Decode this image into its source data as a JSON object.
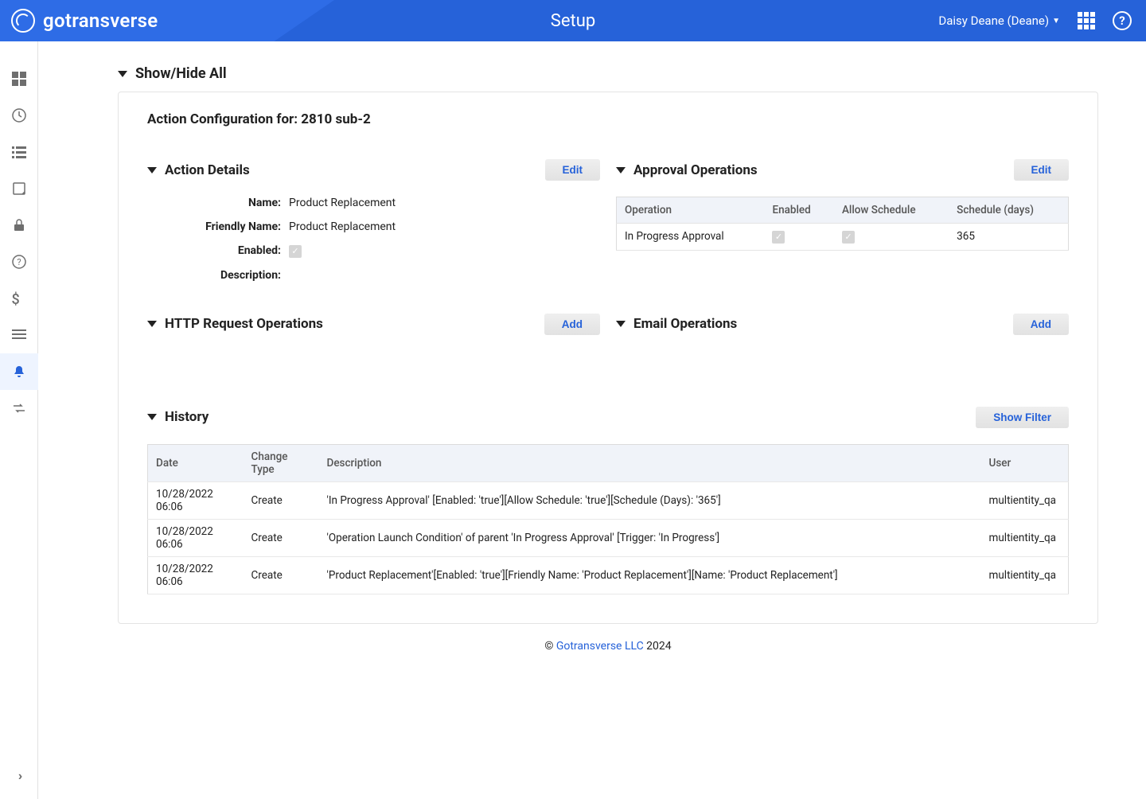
{
  "brand": "gotransverse",
  "header": {
    "title": "Setup",
    "user": "Daisy Deane (Deane)"
  },
  "showhide": "Show/Hide All",
  "card_title": "Action Configuration for: 2810 sub-2",
  "sections": {
    "action_details": {
      "title": "Action Details",
      "button": "Edit",
      "labels": {
        "name": "Name:",
        "friendly": "Friendly Name:",
        "enabled": "Enabled:",
        "description": "Description:"
      },
      "values": {
        "name": "Product Replacement",
        "friendly": "Product Replacement",
        "enabled": true,
        "description": ""
      }
    },
    "approval": {
      "title": "Approval Operations",
      "button": "Edit",
      "headers": {
        "operation": "Operation",
        "enabled": "Enabled",
        "allow": "Allow Schedule",
        "schedule": "Schedule (days)"
      },
      "row": {
        "operation": "In Progress Approval",
        "enabled": true,
        "allow": true,
        "schedule": "365"
      }
    },
    "http": {
      "title": "HTTP Request Operations",
      "button": "Add"
    },
    "email": {
      "title": "Email Operations",
      "button": "Add"
    },
    "history": {
      "title": "History",
      "button": "Show Filter",
      "headers": {
        "date": "Date",
        "type": "Change Type",
        "description": "Description",
        "user": "User"
      },
      "rows": [
        {
          "date": "10/28/2022 06:06",
          "type": "Create",
          "description": "'In Progress Approval' [Enabled: 'true'][Allow Schedule: 'true'][Schedule (Days): '365']",
          "user": "multientity_qa"
        },
        {
          "date": "10/28/2022 06:06",
          "type": "Create",
          "description": "'Operation Launch Condition' of parent 'In Progress Approval' [Trigger: 'In Progress']",
          "user": "multientity_qa"
        },
        {
          "date": "10/28/2022 06:06",
          "type": "Create",
          "description": "'Product Replacement'[Enabled: 'true'][Friendly Name: 'Product Replacement'][Name: 'Product Replacement']",
          "user": "multientity_qa"
        }
      ]
    }
  },
  "footer": {
    "copy": "© ",
    "link": "Gotransverse LLC",
    "year": " 2024"
  }
}
